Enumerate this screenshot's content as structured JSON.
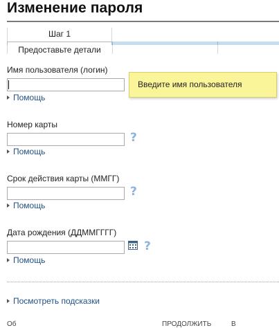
{
  "page": {
    "title": "Изменение пароля"
  },
  "steps": [
    {
      "name": "Шаг 1",
      "description": "Предоставьте детали",
      "active": true
    },
    {
      "name": "",
      "description": "",
      "active": false
    },
    {
      "name": "",
      "description": "",
      "active": false
    }
  ],
  "form": {
    "username": {
      "label": "Имя пользователя (логин)",
      "value": "",
      "tooltip": "Введите имя пользователя",
      "help": "Помощь"
    },
    "card_number": {
      "label": "Номер карты",
      "value": "",
      "help": "Помощь",
      "help_icon": "question-icon"
    },
    "card_expiry": {
      "label": "Срок действия карты (ММГГ)",
      "value": "",
      "help": "Помощь",
      "help_icon": "question-icon"
    },
    "birth_date": {
      "label": "Дата рождения (ДДММГГГГ)",
      "value": "",
      "help": "Помощь",
      "help_icon": "question-icon",
      "calendar_icon": "calendar-icon"
    }
  },
  "hints_link": "Посмотреть подсказки",
  "footer": {
    "left_cut": "Об",
    "middle_cut": "ПРОДОЛЖИТЬ",
    "right_cut": "В"
  },
  "colors": {
    "link": "#1f4f85",
    "tooltip_bg": "#fbf59a",
    "help_icon": "#8fb4d9",
    "step_bar": "#c6dcef"
  }
}
